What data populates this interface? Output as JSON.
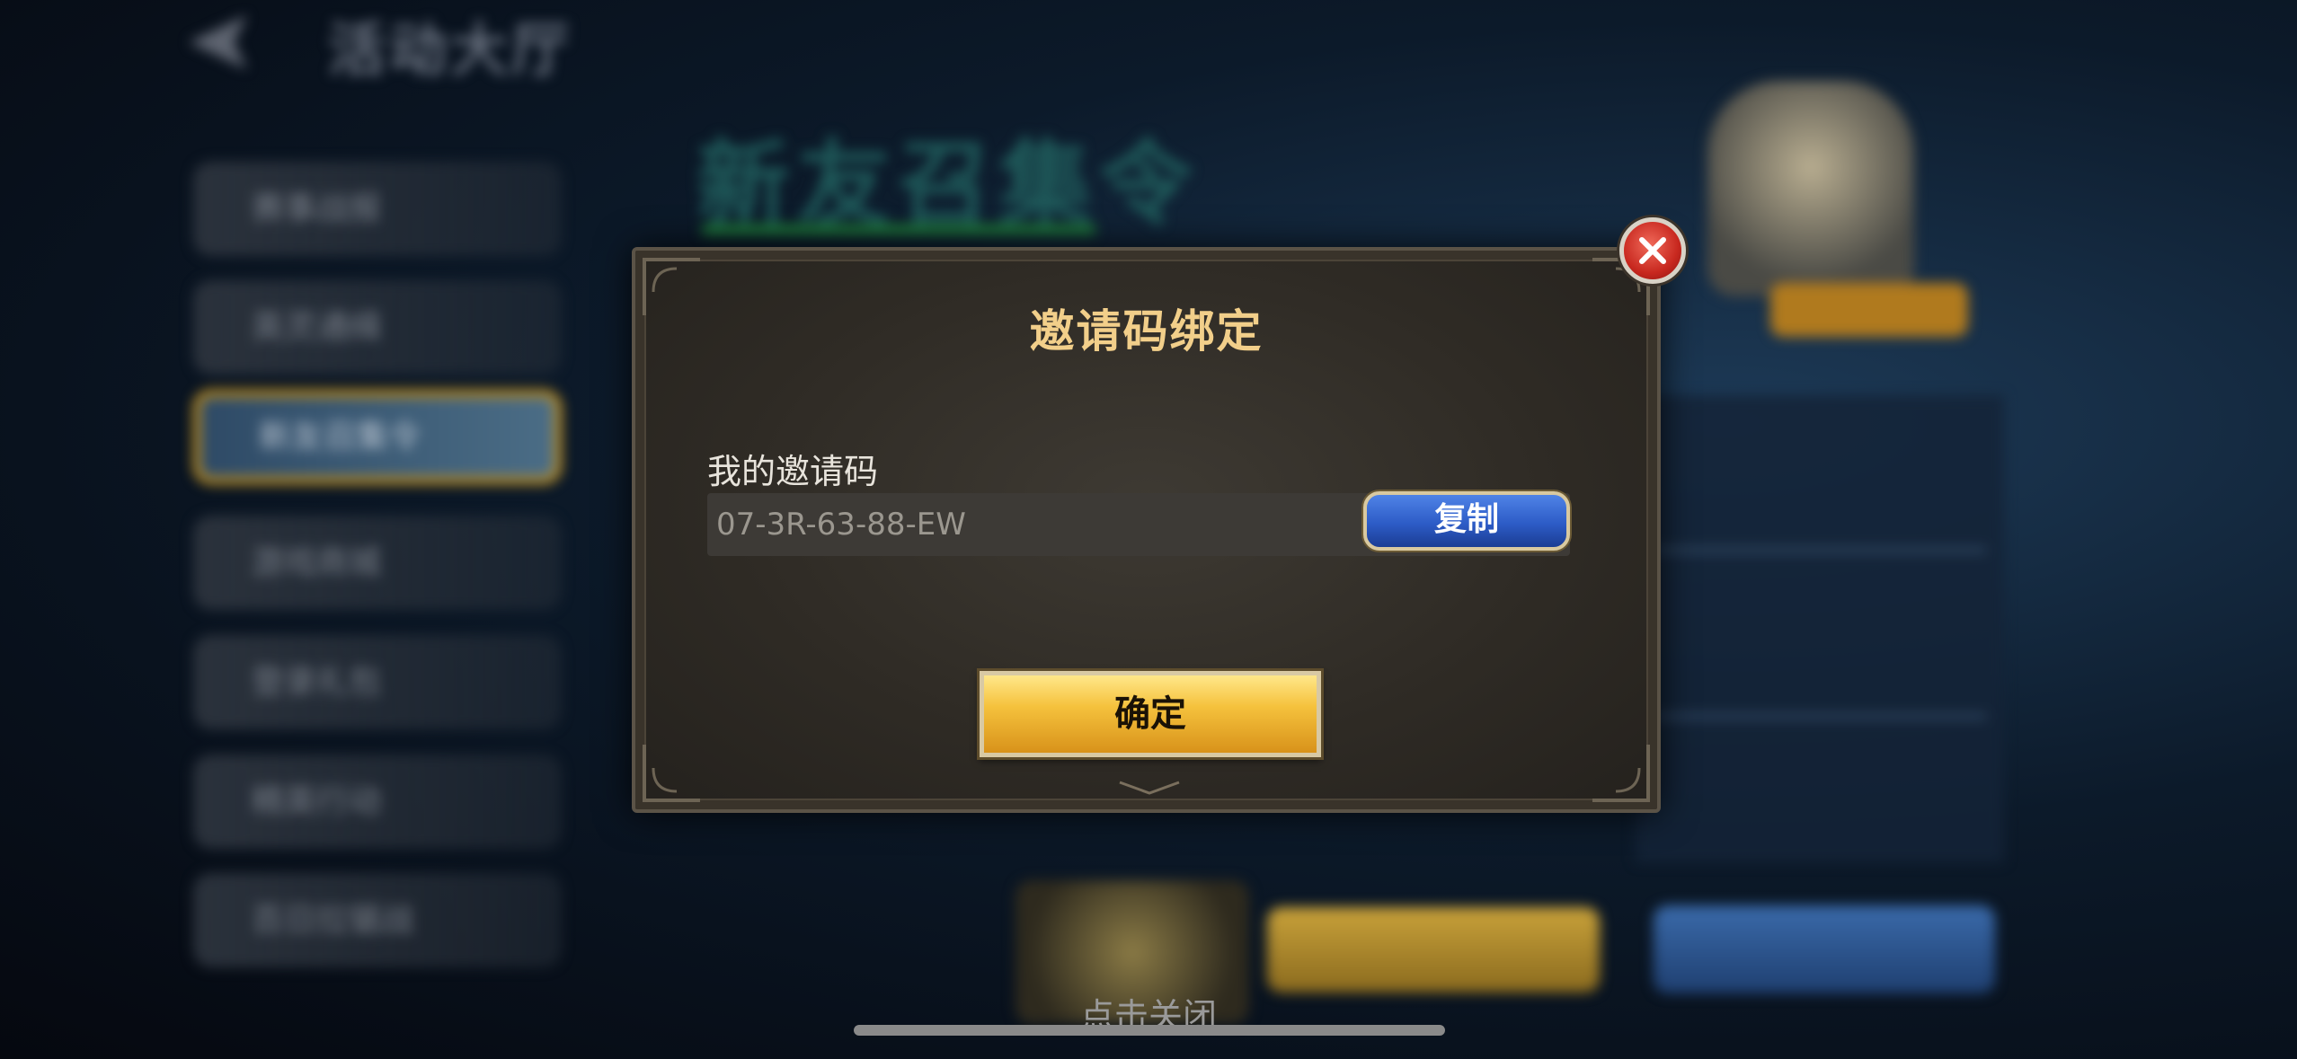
{
  "background": {
    "page_title": "活动大厅",
    "heading": "新友召集令",
    "sidebar_items": [
      "赛事战报",
      "英灵通缉",
      "新友召集令",
      "游戏商城",
      "登录礼包",
      "精英行动",
      "百日拉锯战"
    ],
    "active_sidebar_index": 2
  },
  "dialog": {
    "title": "邀请码绑定",
    "my_code_label": "我的邀请码",
    "invite_code": "07-3R-63-88-EW",
    "copy_button": "复制",
    "confirm_button": "确定"
  },
  "tap_to_close": "点击关闭",
  "colors": {
    "title_gold": "#f2cf8a",
    "copy_blue": "#2d5cc7",
    "confirm_gold": "#f5c23d",
    "close_red": "#c8281f"
  },
  "icons": {
    "back": "back-arrow-icon",
    "close": "close-x-icon"
  }
}
